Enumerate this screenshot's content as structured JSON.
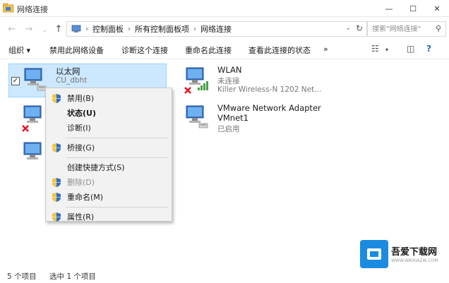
{
  "window": {
    "title": "网络连接",
    "minimize": "—",
    "maximize": "☐",
    "close": "✕"
  },
  "address": {
    "back": "←",
    "forward": "→",
    "up": "↑",
    "crumbs": [
      "控制面板",
      "所有控制面板项",
      "网络连接"
    ],
    "separator": "›",
    "dropdown": "⌄",
    "refresh": "↻",
    "search_placeholder": "搜索\"网络连接\""
  },
  "commands": {
    "organize": "组织 ▾",
    "disable_device": "禁用此网络设备",
    "diagnose": "诊断这个连接",
    "rename": "重命名此连接",
    "view_status": "查看此连接的状态",
    "more": "»"
  },
  "items": [
    {
      "name": "以太网",
      "sub1": "CU_dbht",
      "sub2": "",
      "selected": true
    },
    {
      "name": "WLAN",
      "sub1": "未连接",
      "sub2": "Killer Wireless-N 1202 Net...",
      "selected": false
    },
    {
      "name": "VMware Network Adapter VMnet1",
      "line1": "VMware Network Adapter",
      "line2": "VMnet1",
      "sub": "已启用",
      "selected": false
    }
  ],
  "checkbox_mark": "✓",
  "context_menu": [
    {
      "label": "禁用(B)",
      "shield": true,
      "style": "normal"
    },
    {
      "label": "状态(U)",
      "shield": false,
      "style": "bold"
    },
    {
      "label": "诊断(I)",
      "shield": false,
      "style": "normal"
    },
    {
      "sep": true
    },
    {
      "label": "桥接(G)",
      "shield": true,
      "style": "normal"
    },
    {
      "sep": true
    },
    {
      "label": "创建快捷方式(S)",
      "shield": false,
      "style": "normal"
    },
    {
      "label": "删除(D)",
      "shield": true,
      "style": "disabled"
    },
    {
      "label": "重命名(M)",
      "shield": true,
      "style": "normal"
    },
    {
      "sep": true
    },
    {
      "label": "属性(R)",
      "shield": true,
      "style": "normal"
    }
  ],
  "status": {
    "count": "5 个项目",
    "selected": "选中 1 个项目"
  },
  "watermark": {
    "name": "吾爱下载网",
    "url": "WWW.WAIXIAZAI.COM"
  },
  "colors": {
    "selection": "#cce8ff",
    "accent": "#0078d7",
    "error": "#e81123"
  }
}
